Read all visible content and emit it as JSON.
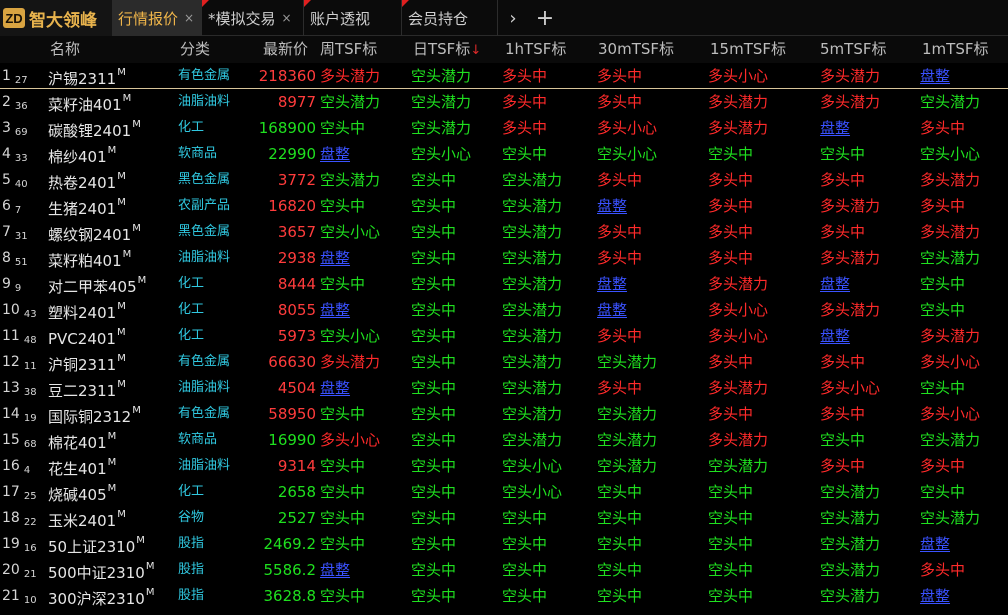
{
  "app": {
    "logo_mark": "ZD",
    "logo_text": "智大领峰"
  },
  "tabs": [
    {
      "label": "行情报价",
      "close": "×",
      "active": true,
      "marked": false
    },
    {
      "label": "*模拟交易",
      "close": "×",
      "active": false,
      "marked": true
    },
    {
      "label": "账户透视",
      "close": "",
      "active": false,
      "marked": true
    },
    {
      "label": "会员持仓",
      "close": "",
      "active": false,
      "marked": true
    }
  ],
  "nav": {
    "next": "›",
    "add": "+"
  },
  "columns": {
    "name": "名称",
    "category": "分类",
    "price": "最新价",
    "weekly": "周TSF标",
    "daily": "日TSF标",
    "daily_sort": "↓",
    "h1": "1hTSF标",
    "m30": "30mTSF标",
    "m15": "15mTSF标",
    "m5": "5mTSF标",
    "m1": "1mTSF标"
  },
  "rows": [
    {
      "idx": "1",
      "sub": "27",
      "name": "沪锡2311",
      "sup": "M",
      "cat": "有色金属",
      "price": "218360",
      "price_color": "red",
      "signals": [
        "多头潜力",
        "空头潜力",
        "多头中",
        "多头中",
        "多头小心",
        "多头潜力",
        "盘整"
      ]
    },
    {
      "idx": "2",
      "sub": "36",
      "name": "菜籽油401",
      "sup": "M",
      "cat": "油脂油料",
      "price": "8977",
      "price_color": "red",
      "signals": [
        "空头潜力",
        "空头潜力",
        "多头中",
        "多头中",
        "多头潜力",
        "多头潜力",
        "空头潜力"
      ]
    },
    {
      "idx": "3",
      "sub": "69",
      "name": "碳酸锂2401",
      "sup": "M",
      "cat": "化工",
      "price": "168900",
      "price_color": "green",
      "signals": [
        "空头中",
        "空头潜力",
        "多头中",
        "多头小心",
        "多头潜力",
        "盘整",
        "多头中"
      ]
    },
    {
      "idx": "4",
      "sub": "33",
      "name": "棉纱401",
      "sup": "M",
      "cat": "软商品",
      "price": "22990",
      "price_color": "green",
      "signals": [
        "盘整",
        "空头小心",
        "空头中",
        "空头小心",
        "空头中",
        "空头中",
        "空头小心"
      ]
    },
    {
      "idx": "5",
      "sub": "40",
      "name": "热卷2401",
      "sup": "M",
      "cat": "黑色金属",
      "price": "3772",
      "price_color": "red",
      "signals": [
        "空头潜力",
        "空头中",
        "空头潜力",
        "多头中",
        "多头中",
        "多头中",
        "多头潜力"
      ]
    },
    {
      "idx": "6",
      "sub": "7",
      "name": "生猪2401",
      "sup": "M",
      "cat": "农副产品",
      "price": "16820",
      "price_color": "red",
      "signals": [
        "空头中",
        "空头中",
        "空头潜力",
        "盘整",
        "多头中",
        "多头潜力",
        "多头中"
      ]
    },
    {
      "idx": "7",
      "sub": "31",
      "name": "螺纹钢2401",
      "sup": "M",
      "cat": "黑色金属",
      "price": "3657",
      "price_color": "red",
      "signals": [
        "空头小心",
        "空头中",
        "空头潜力",
        "多头中",
        "多头中",
        "多头中",
        "多头潜力"
      ]
    },
    {
      "idx": "8",
      "sub": "51",
      "name": "菜籽粕401",
      "sup": "M",
      "cat": "油脂油料",
      "price": "2938",
      "price_color": "red",
      "signals": [
        "盘整",
        "空头中",
        "空头潜力",
        "多头中",
        "多头中",
        "多头潜力",
        "空头潜力"
      ]
    },
    {
      "idx": "9",
      "sub": "9",
      "name": "对二甲苯405",
      "sup": "M",
      "cat": "化工",
      "price": "8444",
      "price_color": "red",
      "signals": [
        "空头中",
        "空头中",
        "空头潜力",
        "盘整",
        "多头潜力",
        "盘整",
        "空头中"
      ]
    },
    {
      "idx": "10",
      "sub": "43",
      "name": "塑料2401",
      "sup": "M",
      "cat": "化工",
      "price": "8055",
      "price_color": "red",
      "signals": [
        "盘整",
        "空头中",
        "空头潜力",
        "盘整",
        "多头小心",
        "多头潜力",
        "空头中"
      ]
    },
    {
      "idx": "11",
      "sub": "48",
      "name": "PVC2401",
      "sup": "M",
      "cat": "化工",
      "price": "5973",
      "price_color": "red",
      "signals": [
        "空头小心",
        "空头中",
        "空头潜力",
        "多头中",
        "多头小心",
        "盘整",
        "多头潜力"
      ]
    },
    {
      "idx": "12",
      "sub": "11",
      "name": "沪铜2311",
      "sup": "M",
      "cat": "有色金属",
      "price": "66630",
      "price_color": "red",
      "signals": [
        "多头潜力",
        "空头中",
        "空头潜力",
        "空头潜力",
        "多头中",
        "多头中",
        "多头小心"
      ]
    },
    {
      "idx": "13",
      "sub": "38",
      "name": "豆二2311",
      "sup": "M",
      "cat": "油脂油料",
      "price": "4504",
      "price_color": "red",
      "signals": [
        "盘整",
        "空头中",
        "空头潜力",
        "多头中",
        "多头潜力",
        "多头小心",
        "空头中"
      ]
    },
    {
      "idx": "14",
      "sub": "19",
      "name": "国际铜2312",
      "sup": "M",
      "cat": "有色金属",
      "price": "58950",
      "price_color": "red",
      "signals": [
        "空头中",
        "空头中",
        "空头潜力",
        "空头潜力",
        "多头中",
        "多头中",
        "多头小心"
      ]
    },
    {
      "idx": "15",
      "sub": "68",
      "name": "棉花401",
      "sup": "M",
      "cat": "软商品",
      "price": "16990",
      "price_color": "green",
      "signals": [
        "多头小心",
        "空头中",
        "空头潜力",
        "空头潜力",
        "多头潜力",
        "空头中",
        "空头潜力"
      ]
    },
    {
      "idx": "16",
      "sub": "4",
      "name": "花生401",
      "sup": "M",
      "cat": "油脂油料",
      "price": "9314",
      "price_color": "red",
      "signals": [
        "空头中",
        "空头中",
        "空头小心",
        "空头潜力",
        "空头潜力",
        "多头中",
        "多头中"
      ]
    },
    {
      "idx": "17",
      "sub": "25",
      "name": "烧碱405",
      "sup": "M",
      "cat": "化工",
      "price": "2658",
      "price_color": "green",
      "signals": [
        "空头中",
        "空头中",
        "空头小心",
        "空头中",
        "空头中",
        "空头潜力",
        "空头中"
      ]
    },
    {
      "idx": "18",
      "sub": "22",
      "name": "玉米2401",
      "sup": "M",
      "cat": "谷物",
      "price": "2527",
      "price_color": "green",
      "signals": [
        "空头中",
        "空头中",
        "空头中",
        "空头中",
        "空头中",
        "空头潜力",
        "空头潜力"
      ]
    },
    {
      "idx": "19",
      "sub": "16",
      "name": "50上证2310",
      "sup": "M",
      "cat": "股指",
      "price": "2469.2",
      "price_color": "green",
      "signals": [
        "空头中",
        "空头中",
        "空头中",
        "空头中",
        "空头中",
        "空头潜力",
        "盘整"
      ]
    },
    {
      "idx": "20",
      "sub": "21",
      "name": "500中证2310",
      "sup": "M",
      "cat": "股指",
      "price": "5586.2",
      "price_color": "green",
      "signals": [
        "盘整",
        "空头中",
        "空头中",
        "空头中",
        "空头中",
        "空头潜力",
        "多头中"
      ]
    },
    {
      "idx": "21",
      "sub": "10",
      "name": "300沪深2310",
      "sup": "M",
      "cat": "股指",
      "price": "3628.8",
      "price_color": "green",
      "signals": [
        "空头中",
        "空头中",
        "空头中",
        "空头中",
        "空头中",
        "空头潜力",
        "盘整"
      ]
    }
  ],
  "colors": {
    "bull": "#ff2a2a",
    "bear": "#1fe01f",
    "flat": "#3a52ff",
    "category": "#30c8e0",
    "accent": "#f0b64a"
  }
}
